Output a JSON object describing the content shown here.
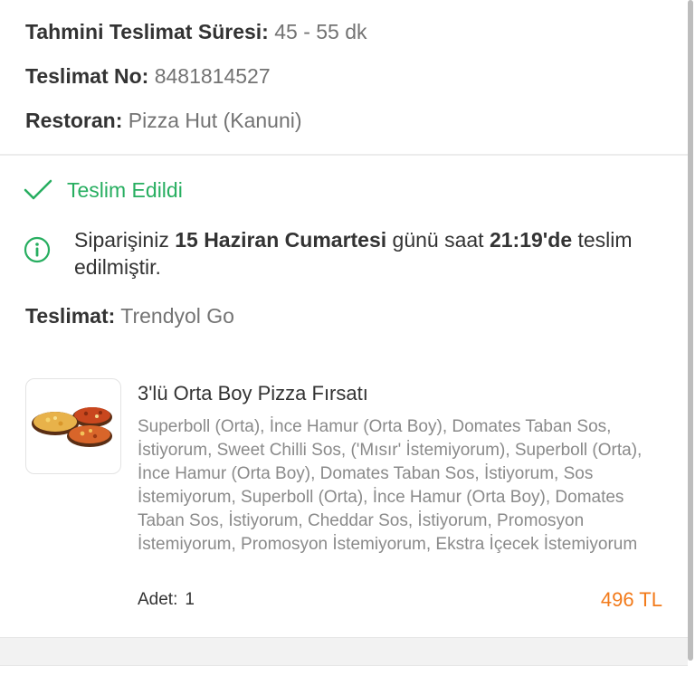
{
  "order_info": {
    "eta_label": "Tahmini Teslimat Süresi:",
    "eta_value": "45 - 55 dk",
    "delivery_no_label": "Teslimat No:",
    "delivery_no_value": "8481814527",
    "restaurant_label": "Restoran:",
    "restaurant_value": "Pizza Hut (Kanuni)"
  },
  "status": {
    "label": "Teslim Edildi",
    "icon": "check-icon",
    "color": "#27ae60"
  },
  "notice": {
    "icon": "info-icon",
    "part1": "Siparişiniz ",
    "date": "15 Haziran Cumartesi",
    "part2": " günü saat ",
    "time": "21:19'de",
    "part3": " teslim edilmiştir."
  },
  "delivery": {
    "label": "Teslimat:",
    "value": "Trendyol Go"
  },
  "product": {
    "image": "pizza-image",
    "name": "3'lü Orta Boy Pizza Fırsatı",
    "description": "Superboll (Orta), İnce Hamur (Orta Boy), Domates Taban Sos, İstiyorum, Sweet Chilli Sos, ('Mısır' İstemiyorum), Superboll (Orta), İnce Hamur (Orta Boy), Domates Taban Sos, İstiyorum, Sos İstemiyorum, Superboll (Orta), İnce Hamur (Orta Boy), Domates Taban Sos, İstiyorum, Cheddar Sos, İstiyorum, Promosyon İstemiyorum, Promosyon İstemiyorum, Ekstra İçecek İstemiyorum",
    "qty_label": "Adet:",
    "qty_value": "1",
    "price": "496 TL",
    "price_color": "#f27a1a"
  }
}
